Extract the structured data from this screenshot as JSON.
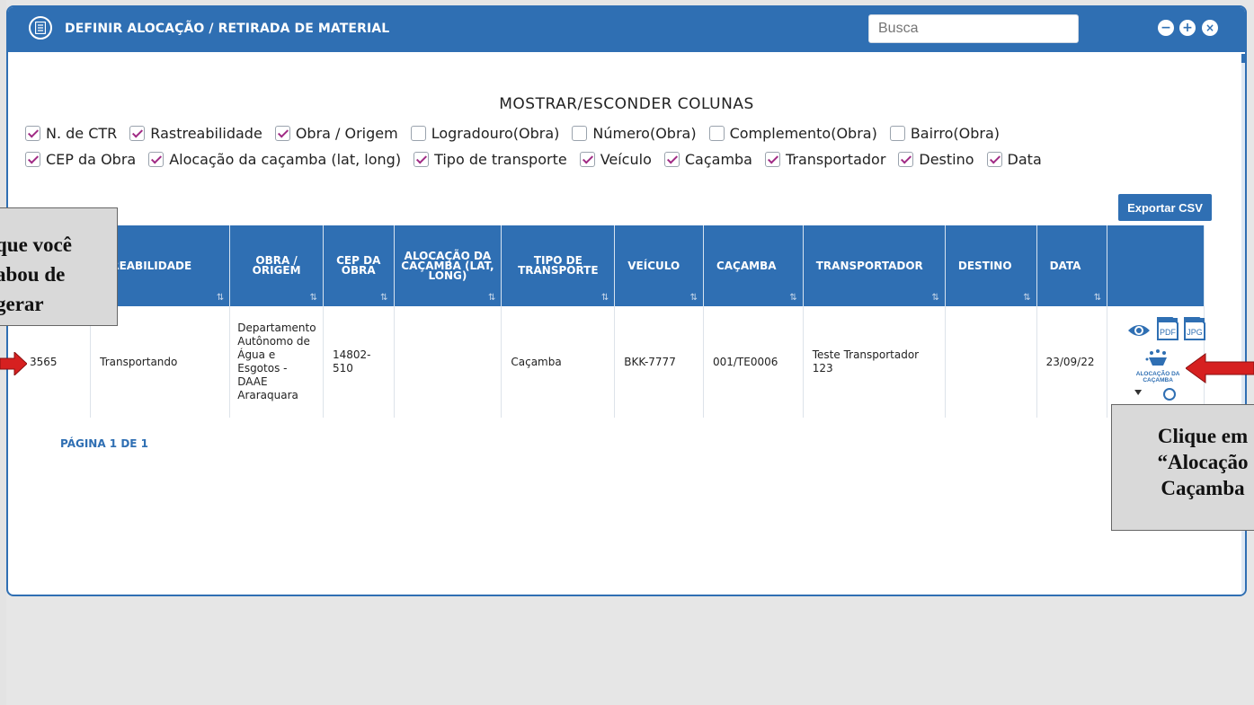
{
  "window": {
    "title": "DEFINIR ALOCAÇÃO / RETIRADA DE MATERIAL",
    "search_placeholder": "Busca"
  },
  "columns_panel": {
    "title": "MOSTRAR/ESCONDER COLUNAS",
    "row1": [
      {
        "label": "N. de CTR",
        "checked": true
      },
      {
        "label": "Rastreabilidade",
        "checked": true
      },
      {
        "label": "Obra / Origem",
        "checked": true
      },
      {
        "label": "Logradouro(Obra)",
        "checked": false
      },
      {
        "label": "Número(Obra)",
        "checked": false
      },
      {
        "label": "Complemento(Obra)",
        "checked": false
      },
      {
        "label": "Bairro(Obra)",
        "checked": false
      }
    ],
    "row2": [
      {
        "label": "CEP da Obra",
        "checked": true
      },
      {
        "label": "Alocação da caçamba (lat, long)",
        "checked": true
      },
      {
        "label": "Tipo de transporte",
        "checked": true
      },
      {
        "label": "Veículo",
        "checked": true
      },
      {
        "label": "Caçamba",
        "checked": true
      },
      {
        "label": "Transportador",
        "checked": true
      },
      {
        "label": "Destino",
        "checked": true
      },
      {
        "label": "Data",
        "checked": true
      }
    ]
  },
  "export_label": "Exportar CSV",
  "table": {
    "headers": [
      "",
      "TREABILIDADE",
      "OBRA / ORIGEM",
      "CEP DA OBRA",
      "ALOCAÇÃO DA CAÇAMBA (LAT, LONG)",
      "TIPO DE TRANSPORTE",
      "VEÍCULO",
      "CAÇAMBA",
      "TRANSPORTADOR",
      "DESTINO",
      "DATA",
      ""
    ],
    "sort_glyph": "⇅",
    "rows": [
      {
        "ctr": "3565",
        "rastreabilidade": "Transportando",
        "obra": "Departamento Autônomo de Água e Esgotos - DAAE Araraquara",
        "cep": "14802-510",
        "alocacao": "",
        "tipo": "Caçamba",
        "veiculo": "BKK-7777",
        "cacamba": "001/TE0006",
        "transportador": "Teste Transportador 123",
        "destino": "",
        "data": "23/09/22"
      }
    ],
    "action_labels": {
      "pdf": "PDF",
      "jpg": "JPG",
      "alocacao": "ALOCAÇÃO DA CAÇAMBA"
    }
  },
  "pager": "PÁGINA 1 DE 1",
  "callouts": {
    "left": "que você abou de gerar",
    "right": "Clique em “Alocação Caçamba"
  },
  "colors": {
    "primary": "#2f6fb3",
    "check": "#a02a84",
    "arrow": "#d62020"
  }
}
